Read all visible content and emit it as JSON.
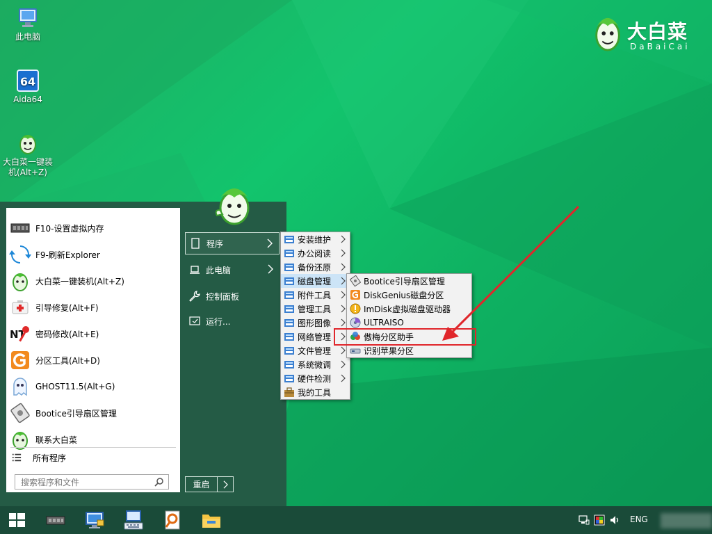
{
  "desktop": {
    "icons": [
      {
        "label": "此电脑",
        "icon": "computer-icon"
      },
      {
        "label": "Aida64",
        "icon": "aida64-icon",
        "badge": "64"
      },
      {
        "label": "大白菜一键装机(Alt+Z)",
        "icon": "dabaicai-icon"
      }
    ]
  },
  "brand": {
    "cn": "大白菜",
    "en": "DaBaiCai"
  },
  "start_menu": {
    "left_items": [
      {
        "label": "F10-设置虚拟内存",
        "icon": "memory-chip-icon"
      },
      {
        "label": "F9-刷新Explorer",
        "icon": "refresh-icon"
      },
      {
        "label": "大白菜一键装机(Alt+Z)",
        "icon": "dabaicai-icon"
      },
      {
        "label": "引导修复(Alt+F)",
        "icon": "first-aid-icon"
      },
      {
        "label": "密码修改(Alt+E)",
        "icon": "password-key-icon"
      },
      {
        "label": "分区工具(Alt+D)",
        "icon": "diskgenius-icon"
      },
      {
        "label": "GHOST11.5(Alt+G)",
        "icon": "ghost-icon"
      },
      {
        "label": "Bootice引导扇区管理",
        "icon": "bootice-icon"
      },
      {
        "label": "联系大白菜",
        "icon": "dabaicai-icon"
      }
    ],
    "all_programs": "所有程序",
    "search_placeholder": "搜索程序和文件",
    "right_items": [
      {
        "label": "程序",
        "icon": "program-icon"
      },
      {
        "label": "此电脑",
        "icon": "laptop-icon"
      },
      {
        "label": "控制面板",
        "icon": "wrench-icon"
      },
      {
        "label": "运行...",
        "icon": "run-icon"
      }
    ],
    "restart_label": "重启"
  },
  "programs_submenu": [
    {
      "label": "安装维护"
    },
    {
      "label": "办公阅读"
    },
    {
      "label": "备份还原"
    },
    {
      "label": "磁盘管理"
    },
    {
      "label": "附件工具"
    },
    {
      "label": "管理工具"
    },
    {
      "label": "图形图像"
    },
    {
      "label": "网络管理"
    },
    {
      "label": "文件管理"
    },
    {
      "label": "系统微调"
    },
    {
      "label": "硬件检测"
    },
    {
      "label": "我的工具"
    }
  ],
  "disk_submenu": [
    {
      "label": "Bootice引导扇区管理",
      "icon": "bootice-icon"
    },
    {
      "label": "DiskGenius磁盘分区",
      "icon": "diskgenius-icon"
    },
    {
      "label": "ImDisk虚拟磁盘驱动器",
      "icon": "imdisk-icon"
    },
    {
      "label": "ULTRAISO",
      "icon": "ultraiso-icon"
    },
    {
      "label": "傲梅分区助手",
      "icon": "aomei-icon"
    },
    {
      "label": "识别苹果分区",
      "icon": "apple-partition-icon"
    }
  ],
  "taskbar": {
    "lang": "ENG",
    "apps": [
      "memory-chip-icon",
      "network-monitor-icon",
      "keyboard-icon",
      "search-tool-icon",
      "file-explorer-icon"
    ]
  },
  "colors": {
    "start_bg": "#245b45",
    "taskbar_bg": "#1a4b39",
    "highlight": "#cce4f7",
    "annotation_red": "#e0262b"
  }
}
